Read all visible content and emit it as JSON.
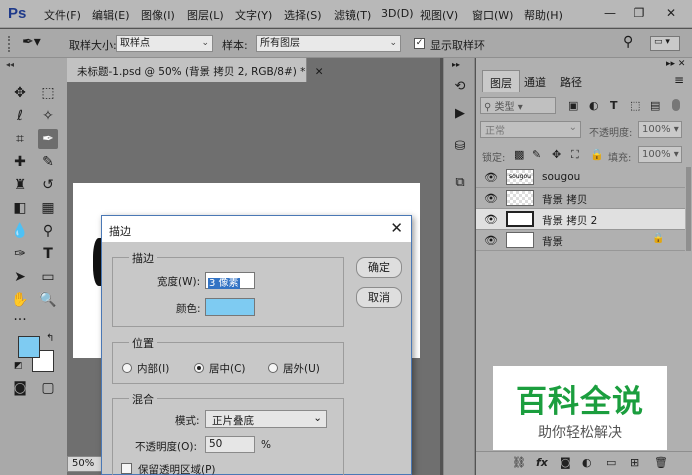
{
  "app": {
    "logo": "Ps"
  },
  "menu": [
    "文件(F)",
    "编辑(E)",
    "图像(I)",
    "图层(L)",
    "文字(Y)",
    "选择(S)",
    "滤镜(T)",
    "3D(D)",
    "视图(V)",
    "窗口(W)",
    "帮助(H)"
  ],
  "options": {
    "sample_size_label": "取样大小:",
    "sample_size_value": "取样点",
    "sample_label": "样本:",
    "sample_value": "所有图层",
    "show_ring_label": "显示取样环",
    "show_ring_checked": true
  },
  "document": {
    "tab_title": "未标题-1.psd @ 50% (背景 拷贝 2, RGB/8#) *",
    "zoom": "50%"
  },
  "layers_panel": {
    "tabs": [
      "图层",
      "通道",
      "路径"
    ],
    "filter_placeholder": "类型",
    "blend_mode": "正常",
    "opacity_label": "不透明度:",
    "opacity_value": "100%",
    "lock_label": "锁定:",
    "fill_label": "填充:",
    "fill_value": "100%",
    "layers": [
      {
        "name": "sougou",
        "thumb_text": "sougou",
        "selected": false,
        "locked": false
      },
      {
        "name": "背景 拷贝",
        "thumb_text": "",
        "selected": false,
        "locked": false
      },
      {
        "name": "背景 拷贝 2",
        "thumb_text": "",
        "selected": true,
        "locked": false
      },
      {
        "name": "背景",
        "thumb_text": "",
        "selected": false,
        "locked": true
      }
    ]
  },
  "dialog": {
    "title": "描边",
    "stroke_group": "描边",
    "width_label": "宽度(W):",
    "width_value": "3 像素",
    "color_label": "颜色:",
    "stroke_color": "#7ecbf2",
    "ok_label": "确定",
    "cancel_label": "取消",
    "position_group": "位置",
    "positions": [
      "内部(I)",
      "居中(C)",
      "居外(U)"
    ],
    "selected_position": "居中(C)",
    "blend_group": "混合",
    "mode_label": "模式:",
    "mode_value": "正片叠底",
    "opacity_label": "不透明度(O):",
    "opacity_value": "50",
    "opacity_unit": "%",
    "preserve_label": "保留透明区域(P)"
  },
  "watermark": {
    "title": "百科全说",
    "subtitle": "助你轻松解决"
  },
  "colors": {
    "foreground": "#7ecbf2",
    "background": "#ffffff",
    "accent": "#4a78b5"
  }
}
